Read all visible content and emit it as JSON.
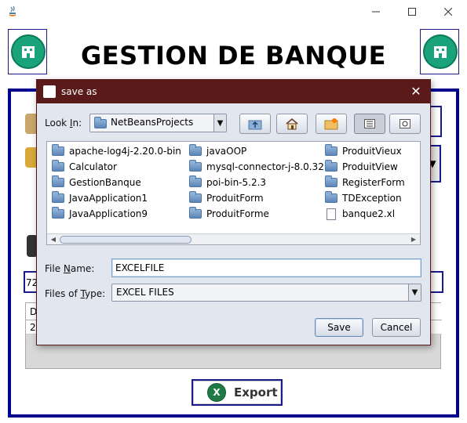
{
  "app": {
    "main_title": "GESTION DE BANQUE",
    "export_label": "Export",
    "background_field_value": "72",
    "background_table_header": "D",
    "background_table_row": "2"
  },
  "dialog": {
    "title": "save as",
    "look_in_label": "Look In:",
    "look_in_label_pre": "Look ",
    "look_in_label_mnemonic": "I",
    "look_in_label_post": "n:",
    "look_in_value": "NetBeansProjects",
    "file_name_label_pre": "File ",
    "file_name_label_mnemonic": "N",
    "file_name_label_post": "ame:",
    "file_name_value": "EXCELFILE",
    "files_of_type_label_pre": "Files of ",
    "files_of_type_label_mnemonic": "T",
    "files_of_type_label_post": "ype:",
    "files_of_type_value": "EXCEL FILES",
    "save_label": "Save",
    "cancel_label": "Cancel",
    "files": [
      {
        "name": "apache-log4j-2.20.0-bin",
        "kind": "folder"
      },
      {
        "name": "Calculator",
        "kind": "folder"
      },
      {
        "name": "GestionBanque",
        "kind": "folder"
      },
      {
        "name": "JavaApplication1",
        "kind": "folder"
      },
      {
        "name": "JavaApplication9",
        "kind": "folder"
      },
      {
        "name": "javaOOP",
        "kind": "folder"
      },
      {
        "name": "mysql-connector-j-8.0.32",
        "kind": "folder"
      },
      {
        "name": "poi-bin-5.2.3",
        "kind": "folder"
      },
      {
        "name": "ProduitForm",
        "kind": "folder"
      },
      {
        "name": "ProduitForme",
        "kind": "folder"
      },
      {
        "name": "ProduitVieux",
        "kind": "folder"
      },
      {
        "name": "ProduitView",
        "kind": "folder"
      },
      {
        "name": "RegisterForm",
        "kind": "folder"
      },
      {
        "name": "TDException",
        "kind": "folder"
      },
      {
        "name": "banque2.xl",
        "kind": "file"
      }
    ]
  },
  "colors": {
    "dialog_title_bg": "#5a1a1a",
    "frame_border": "#00008f",
    "logo_green": "#1aa37a",
    "excel_green": "#1f7a45"
  }
}
